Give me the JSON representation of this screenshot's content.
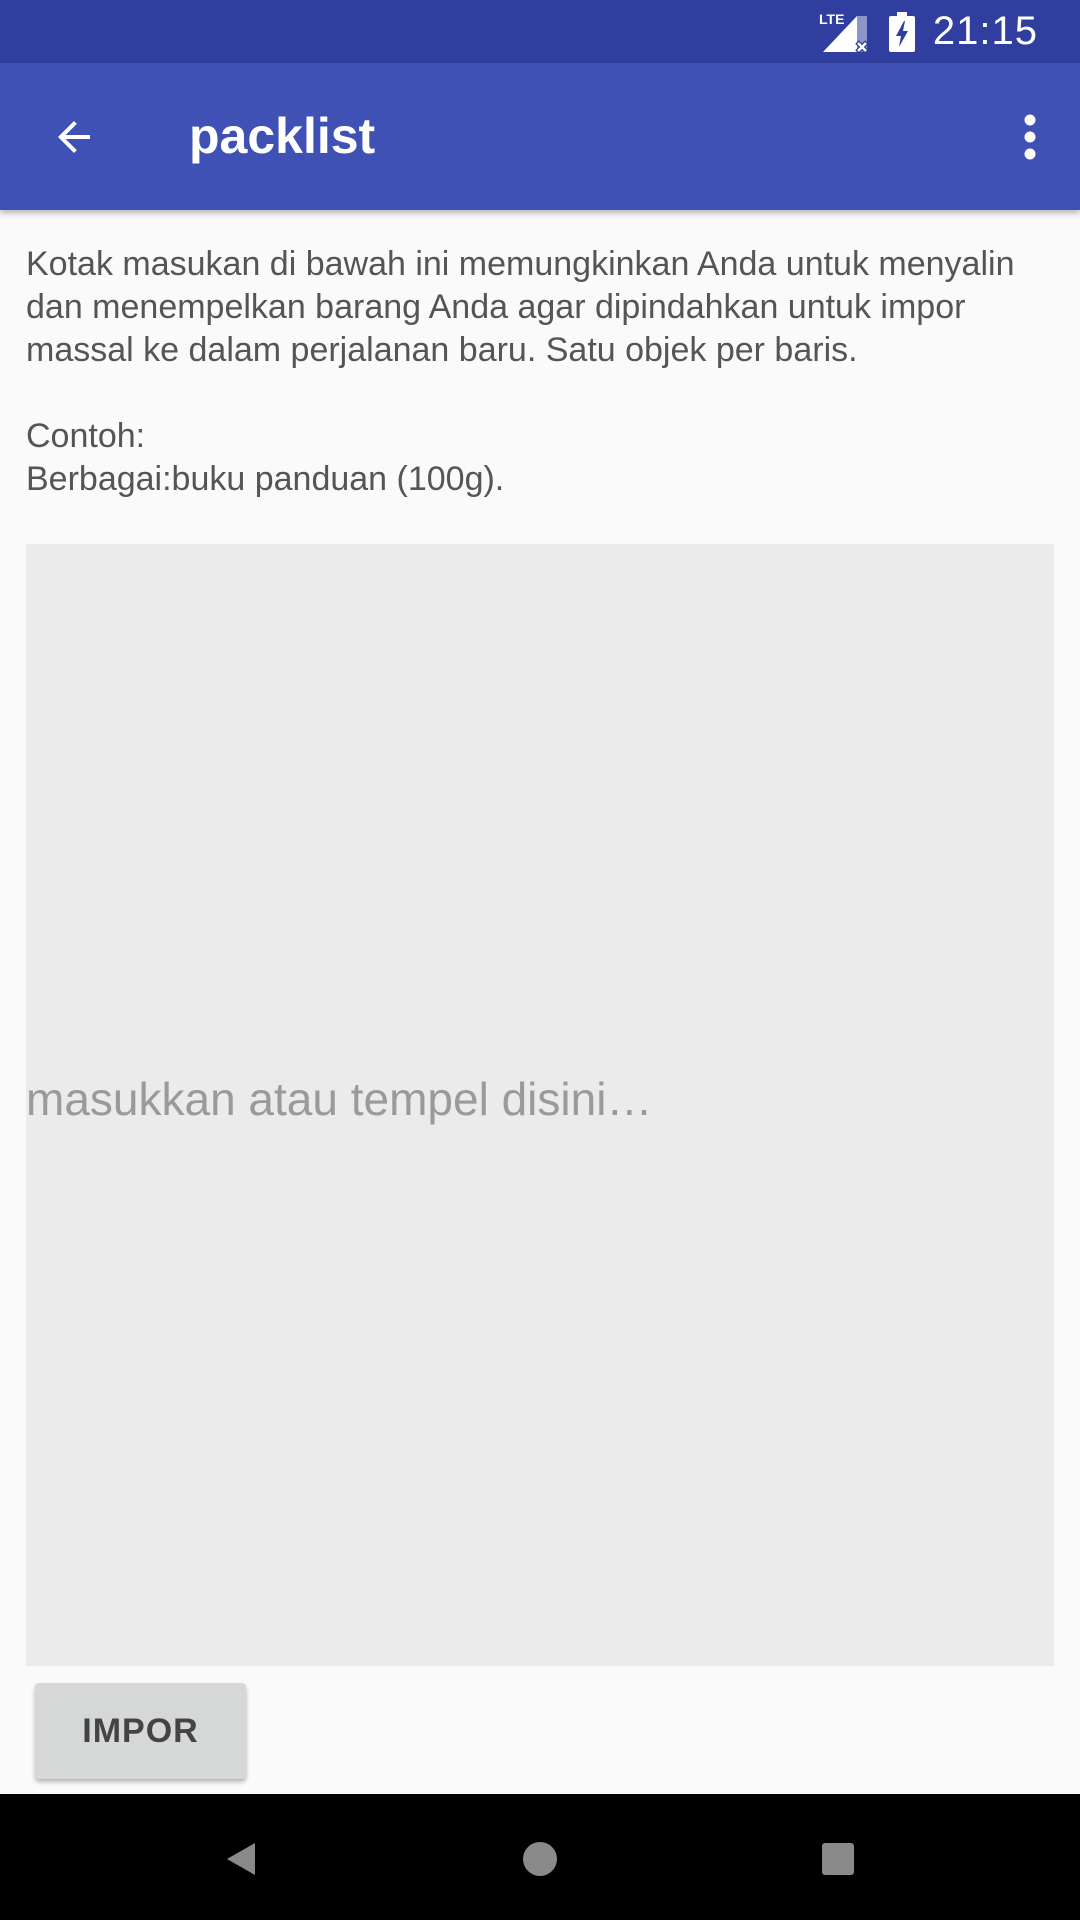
{
  "status_bar": {
    "time": "21:15",
    "network_label": "LTE",
    "icons": [
      "lte-signal-icon",
      "battery-charging-icon"
    ]
  },
  "app_bar": {
    "title": "packlist",
    "back_icon": "arrow-left-icon",
    "menu_icon": "more-vertical-icon"
  },
  "main": {
    "description": "Kotak masukan di bawah ini memungkinkan Anda untuk menyalin dan menempelkan barang Anda agar dipindahkan untuk impor massal ke dalam perjalanan baru. Satu objek per baris.\n\nContoh:\nBerbagai:buku panduan (100g).",
    "input_placeholder": "masukkan atau tempel disini…",
    "input_value": "",
    "import_label": "IMPOR"
  },
  "nav_bar": {
    "icons": [
      "back-triangle-icon",
      "home-circle-icon",
      "recents-square-icon"
    ]
  },
  "colors": {
    "status_bar": "#303f9f",
    "app_bar": "#3f51b5",
    "background": "#fafafa",
    "input_background": "#ebebeb",
    "button_background": "#d6d7d7"
  }
}
